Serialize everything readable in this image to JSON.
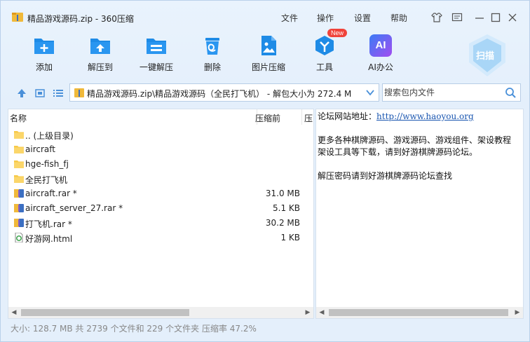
{
  "window": {
    "title": "精品游戏源码.zip - 360压缩",
    "menu": [
      "文件",
      "操作",
      "设置",
      "帮助"
    ]
  },
  "toolbar": {
    "items": [
      {
        "label": "添加",
        "icon": "add-icon"
      },
      {
        "label": "解压到",
        "icon": "extract-to-icon"
      },
      {
        "label": "一键解压",
        "icon": "one-click-extract-icon"
      },
      {
        "label": "删除",
        "icon": "delete-icon"
      },
      {
        "label": "图片压缩",
        "icon": "image-compress-icon"
      },
      {
        "label": "工具",
        "icon": "tools-icon",
        "badge": "New"
      },
      {
        "label": "AI办公",
        "icon": "ai-office-icon",
        "icon_text": "AI"
      }
    ],
    "scan_label": "扫描"
  },
  "address": {
    "path": "精品游戏源码.zip\\精品游戏源码（全民打飞机） - 解包大小为 272.4 M",
    "search_placeholder": "搜索包内文件"
  },
  "file_list": {
    "columns": [
      "名称",
      "压缩前",
      "压"
    ],
    "rows": [
      {
        "name": ".. (上级目录)",
        "size": "",
        "type": "folder"
      },
      {
        "name": "aircraft",
        "size": "",
        "type": "folder"
      },
      {
        "name": "hge-fish_fj",
        "size": "",
        "type": "folder"
      },
      {
        "name": "全民打飞机",
        "size": "",
        "type": "folder"
      },
      {
        "name": "aircraft.rar *",
        "size": "31.0 MB",
        "type": "rar"
      },
      {
        "name": "aircraft_server_27.rar *",
        "size": "5.1 KB",
        "type": "rar"
      },
      {
        "name": "打飞机.rar *",
        "size": "30.2 MB",
        "type": "rar"
      },
      {
        "name": "好游网.html",
        "size": "1 KB",
        "type": "html"
      }
    ]
  },
  "readme": {
    "line1_prefix": "论坛网站地址：",
    "line1_link": "http://www.haoyou.org",
    "line2": "更多各种棋牌源码、游戏源码、游戏组件、架设教程",
    "line3": "架设工具等下载，请到好游棋牌源码论坛。",
    "line4": "解压密码请到好游棋牌源码论坛查找"
  },
  "status": {
    "text": "大小: 128.7 MB 共 2739 个文件和 229 个文件夹 压缩率 47.2%"
  },
  "colors": {
    "accent": "#1e8be6",
    "ai_badge": "#7b4ef0",
    "new_badge": "#f0433a",
    "folder": "#f7c948"
  }
}
